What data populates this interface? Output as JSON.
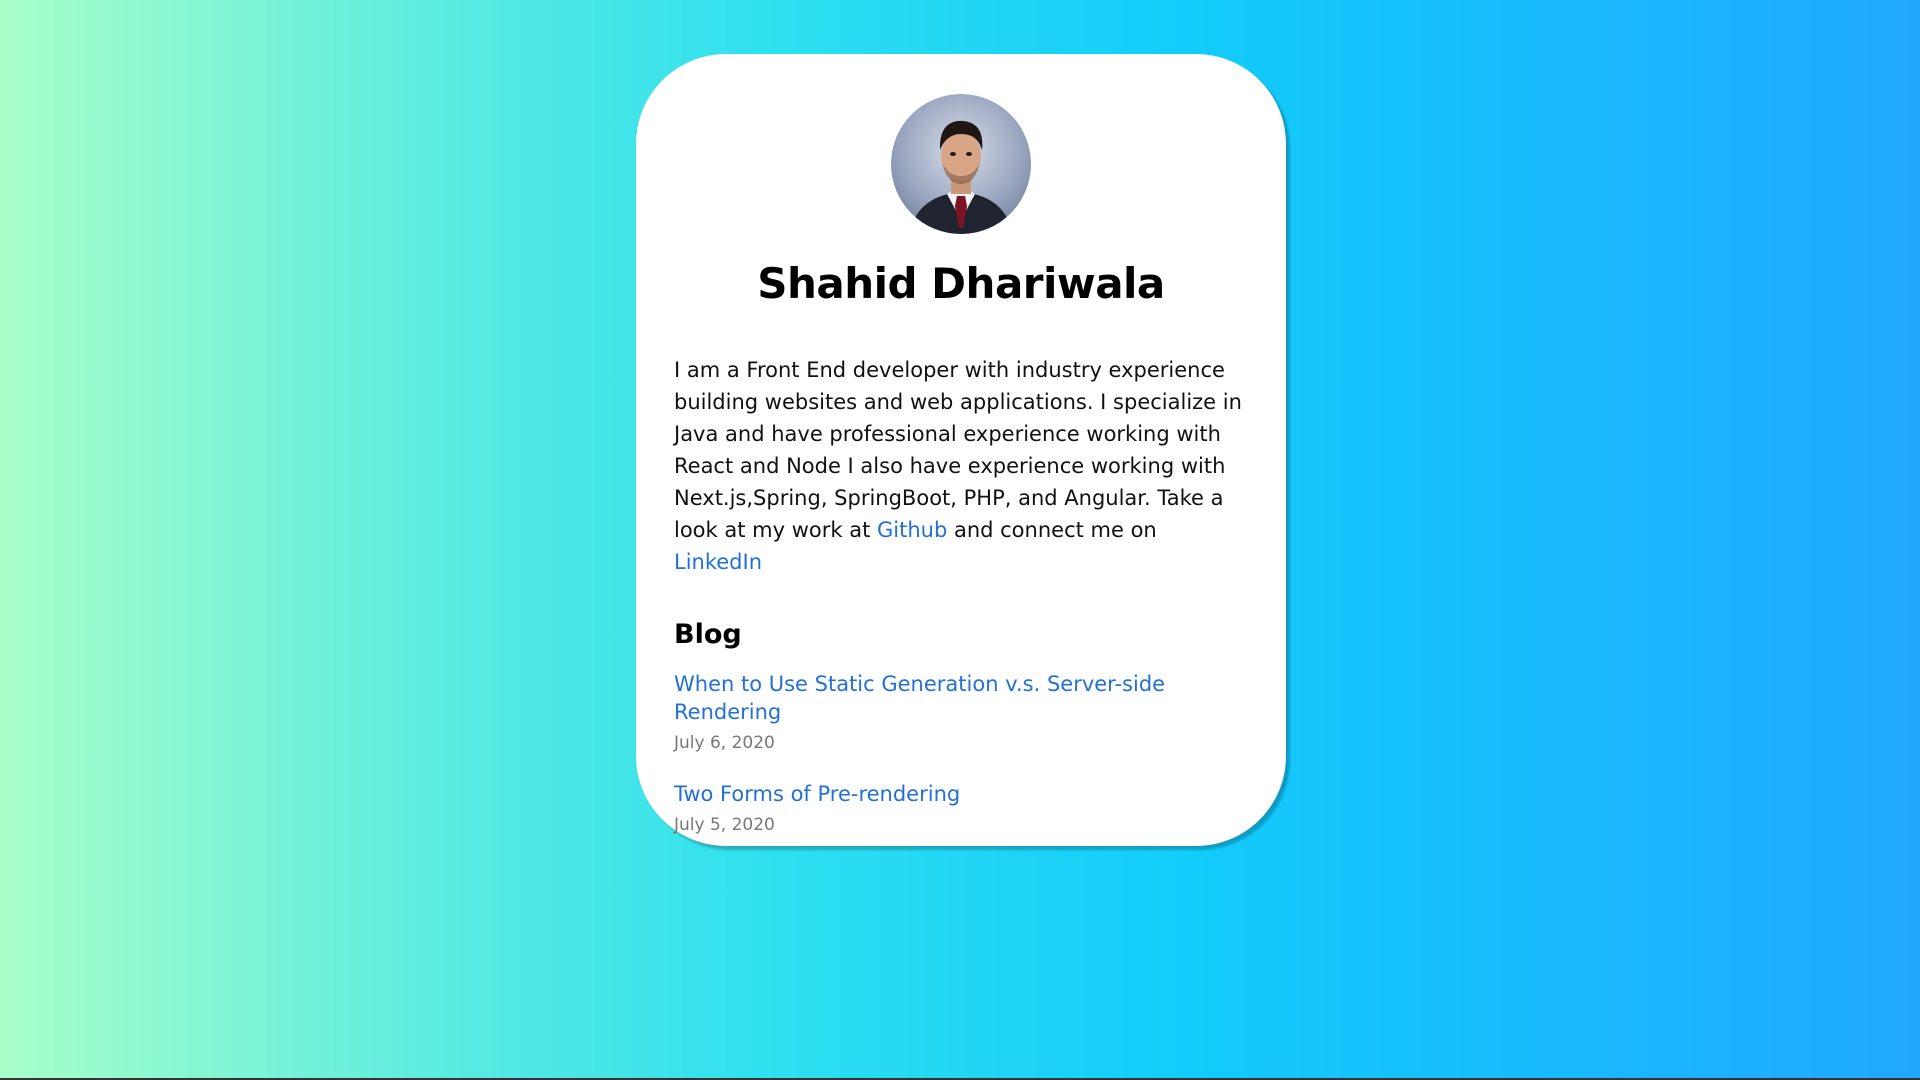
{
  "profile": {
    "name": "Shahid Dhariwala",
    "avatar_alt": "profile-photo"
  },
  "bio": {
    "text_1": "I am a Front End developer with industry experience building websites and web applications. I specialize in Java and have professional experience working with React and Node I also have experience working with Next.js,Spring, SpringBoot, PHP, and Angular. Take a look at my work at ",
    "github_label": "Github",
    "text_2": " and connect me on ",
    "linkedin_label": "LinkedIn"
  },
  "blog": {
    "heading": "Blog",
    "posts": [
      {
        "title": "When to Use Static Generation v.s. Server-side Rendering",
        "date": "July 6, 2020"
      },
      {
        "title": "Two Forms of Pre-rendering",
        "date": "July 5, 2020"
      }
    ]
  },
  "colors": {
    "link": "#2270d8",
    "date": "#777777",
    "card": "#ffffff"
  }
}
